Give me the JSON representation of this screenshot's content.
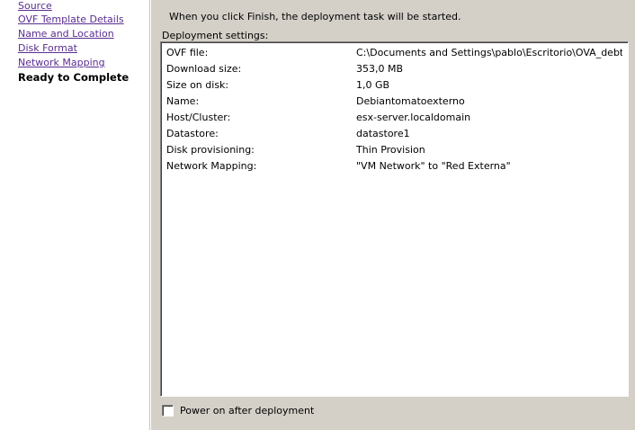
{
  "nav": {
    "items": [
      {
        "label": "Source",
        "state": "link"
      },
      {
        "label": "OVF Template Details",
        "state": "link"
      },
      {
        "label": "Name and Location",
        "state": "link"
      },
      {
        "label": "Disk Format",
        "state": "link"
      },
      {
        "label": "Network Mapping",
        "state": "link"
      },
      {
        "label": "Ready to Complete",
        "state": "current"
      }
    ]
  },
  "main": {
    "intro": "When you click Finish, the deployment task will be started.",
    "settings_label": "Deployment settings:",
    "settings": [
      {
        "label": "OVF file:",
        "value": "C:\\Documents and Settings\\pablo\\Escritorio\\OVA_debtom..."
      },
      {
        "label": "Download size:",
        "value": "353,0 MB"
      },
      {
        "label": "Size on disk:",
        "value": "1,0 GB"
      },
      {
        "label": "Name:",
        "value": "Debiantomatoexterno"
      },
      {
        "label": "Host/Cluster:",
        "value": "esx-server.localdomain"
      },
      {
        "label": "Datastore:",
        "value": "datastore1"
      },
      {
        "label": "Disk provisioning:",
        "value": "Thin Provision"
      },
      {
        "label": "Network Mapping:",
        "value": "\"VM Network\" to \"Red Externa\""
      }
    ],
    "power_on_label": "Power on after deployment",
    "power_on_checked": false
  },
  "colors": {
    "link": "#5a2d91",
    "panel_bg": "#d4d0c8",
    "field_bg": "#ffffff"
  }
}
